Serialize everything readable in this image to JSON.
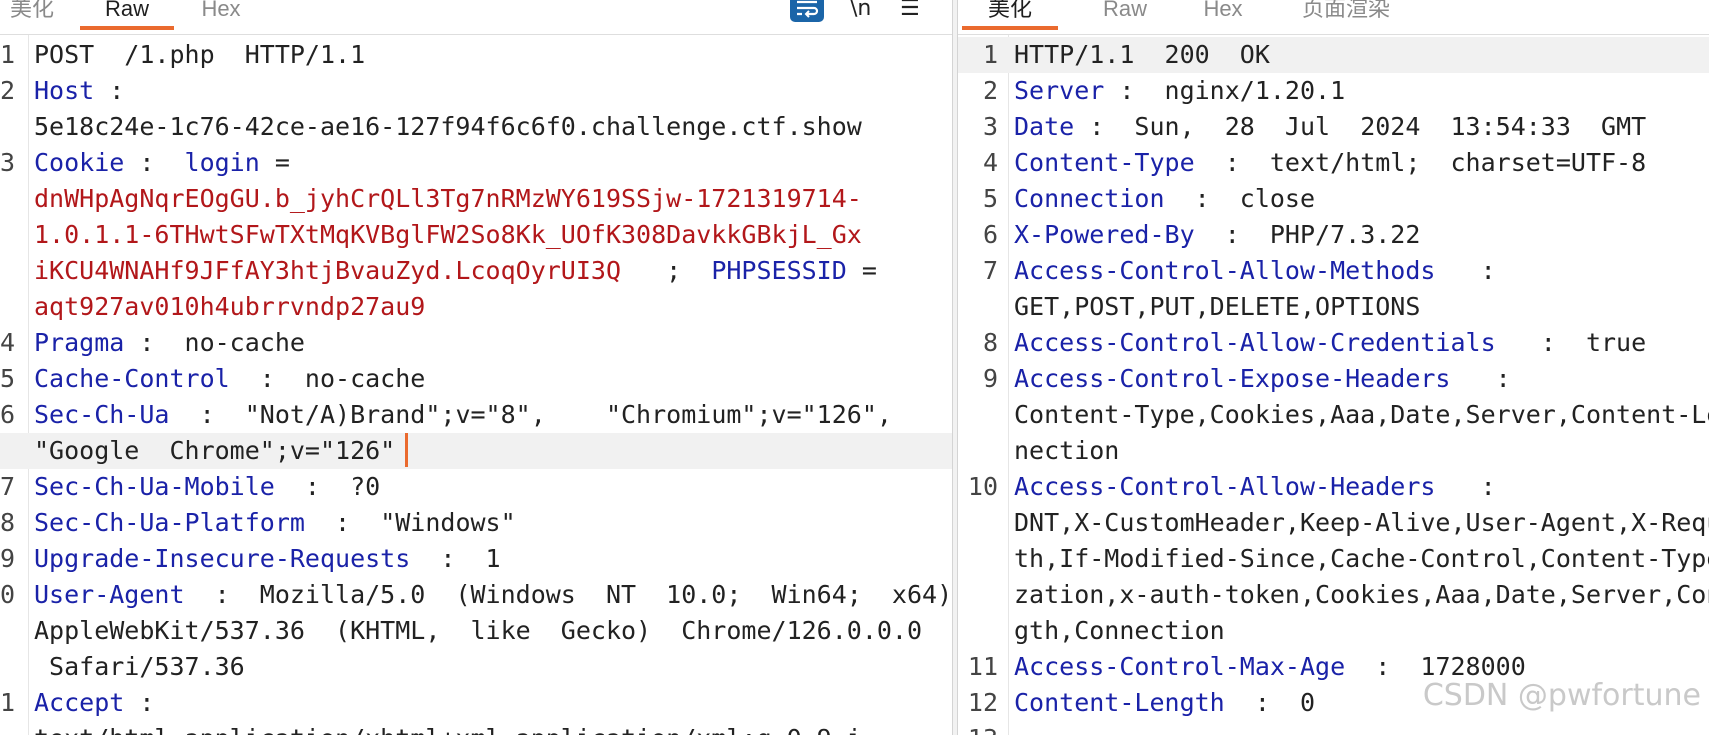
{
  "left": {
    "tabs": [
      "美化",
      "Raw",
      "Hex"
    ],
    "newline_toggle": "\\n",
    "menu_glyph": "☰",
    "lines": [
      {
        "n": "1",
        "parts": [
          {
            "t": "POST  /1.php  HTTP/1.1",
            "c": ""
          }
        ]
      },
      {
        "n": "2",
        "parts": [
          {
            "t": "Host",
            "c": "k"
          },
          {
            "t": " :",
            "c": ""
          }
        ]
      },
      {
        "n": "",
        "parts": [
          {
            "t": "5e18c24e-1c76-42ce-ae16-127f94f6c6f0.challenge.ctf.show",
            "c": ""
          }
        ]
      },
      {
        "n": "3",
        "parts": [
          {
            "t": "Cookie",
            "c": "k"
          },
          {
            "t": " :  ",
            "c": ""
          },
          {
            "t": "login",
            "c": "k"
          },
          {
            "t": " =",
            "c": ""
          }
        ]
      },
      {
        "n": "",
        "parts": [
          {
            "t": "dnWHpAgNqrEOgGU.b_jyhCrQLl3Tg7nRMzWY619SSjw-1721319714-",
            "c": "v"
          }
        ]
      },
      {
        "n": "",
        "parts": [
          {
            "t": "1.0.1.1-6THwtSFwTXtMqKVBglFW2So8Kk_UOfK308DavkkGBkjL_Gx",
            "c": "v"
          }
        ]
      },
      {
        "n": "",
        "parts": [
          {
            "t": "iKCU4WNAHf9JFfAY3htjBvauZyd.LcoqOyrUI3Q",
            "c": "v"
          },
          {
            "t": "   ;  ",
            "c": ""
          },
          {
            "t": "PHPSESSID",
            "c": "k"
          },
          {
            "t": " =",
            "c": ""
          }
        ]
      },
      {
        "n": "",
        "parts": [
          {
            "t": "aqt927av010h4ubrrvndp27au9",
            "c": "v"
          }
        ]
      },
      {
        "n": "4",
        "parts": [
          {
            "t": "Pragma",
            "c": "k"
          },
          {
            "t": " :  no-cache",
            "c": ""
          }
        ]
      },
      {
        "n": "5",
        "parts": [
          {
            "t": "Cache-Control",
            "c": "k"
          },
          {
            "t": "  :  no-cache",
            "c": ""
          }
        ]
      },
      {
        "n": "6",
        "parts": [
          {
            "t": "Sec-Ch-Ua",
            "c": "k"
          },
          {
            "t": "  :  \"Not/A)Brand\";v=\"8\",    \"Chromium\";v=\"126\",",
            "c": ""
          }
        ]
      },
      {
        "n": "",
        "hl": true,
        "cursor": true,
        "parts": [
          {
            "t": "\"Google  Chrome\";v=\"126\"",
            "c": ""
          }
        ]
      },
      {
        "n": "7",
        "parts": [
          {
            "t": "Sec-Ch-Ua-Mobile",
            "c": "k"
          },
          {
            "t": "  :  ?0",
            "c": ""
          }
        ]
      },
      {
        "n": "8",
        "parts": [
          {
            "t": "Sec-Ch-Ua-Platform",
            "c": "k"
          },
          {
            "t": "  :  \"Windows\"",
            "c": ""
          }
        ]
      },
      {
        "n": "9",
        "parts": [
          {
            "t": "Upgrade-Insecure-Requests",
            "c": "k"
          },
          {
            "t": "  :  1",
            "c": ""
          }
        ]
      },
      {
        "n": "0",
        "parts": [
          {
            "t": "User-Agent",
            "c": "k"
          },
          {
            "t": "  :  Mozilla/5.0  (Windows  NT  10.0;  Win64;  x64)",
            "c": ""
          }
        ]
      },
      {
        "n": "",
        "parts": [
          {
            "t": "AppleWebKit/537.36  (KHTML,  like  Gecko)  Chrome/126.0.0.0",
            "c": ""
          }
        ]
      },
      {
        "n": "",
        "parts": [
          {
            "t": " Safari/537.36",
            "c": ""
          }
        ]
      },
      {
        "n": "1",
        "parts": [
          {
            "t": "Accept",
            "c": "k"
          },
          {
            "t": " :",
            "c": ""
          }
        ]
      },
      {
        "n": "",
        "parts": [
          {
            "t": "text/html,application/xhtml+xml,application/xml;q=0.9,i",
            "c": ""
          }
        ]
      }
    ]
  },
  "right": {
    "tabs": [
      "美化",
      "Raw",
      "Hex",
      "页面渲染"
    ],
    "lines": [
      {
        "n": "1",
        "hl": true,
        "parts": [
          {
            "t": "HTTP/1.1  200  OK",
            "c": ""
          }
        ]
      },
      {
        "n": "2",
        "parts": [
          {
            "t": "Server",
            "c": "k"
          },
          {
            "t": " :  nginx/1.20.1",
            "c": ""
          }
        ]
      },
      {
        "n": "3",
        "parts": [
          {
            "t": "Date",
            "c": "k"
          },
          {
            "t": " :  Sun,  28  Jul  2024  13:54:33  GMT",
            "c": ""
          }
        ]
      },
      {
        "n": "4",
        "parts": [
          {
            "t": "Content-Type",
            "c": "k"
          },
          {
            "t": "  :  text/html;  charset=UTF-8",
            "c": ""
          }
        ]
      },
      {
        "n": "5",
        "parts": [
          {
            "t": "Connection",
            "c": "k"
          },
          {
            "t": "  :  close",
            "c": ""
          }
        ]
      },
      {
        "n": "6",
        "parts": [
          {
            "t": "X-Powered-By",
            "c": "k"
          },
          {
            "t": "  :  PHP/7.3.22",
            "c": ""
          }
        ]
      },
      {
        "n": "7",
        "parts": [
          {
            "t": "Access-Control-Allow-Methods",
            "c": "k"
          },
          {
            "t": "   :",
            "c": ""
          }
        ]
      },
      {
        "n": "",
        "parts": [
          {
            "t": "GET,POST,PUT,DELETE,OPTIONS",
            "c": ""
          }
        ]
      },
      {
        "n": "8",
        "parts": [
          {
            "t": "Access-Control-Allow-Credentials",
            "c": "k"
          },
          {
            "t": "   :  true",
            "c": ""
          }
        ]
      },
      {
        "n": "9",
        "parts": [
          {
            "t": "Access-Control-Expose-Headers",
            "c": "k"
          },
          {
            "t": "   :",
            "c": ""
          }
        ]
      },
      {
        "n": "",
        "parts": [
          {
            "t": "Content-Type,Cookies,Aaa,Date,Server,Content-Le",
            "c": ""
          }
        ]
      },
      {
        "n": "",
        "parts": [
          {
            "t": "nection",
            "c": ""
          }
        ]
      },
      {
        "n": "10",
        "parts": [
          {
            "t": "Access-Control-Allow-Headers",
            "c": "k"
          },
          {
            "t": "   :",
            "c": ""
          }
        ]
      },
      {
        "n": "",
        "parts": [
          {
            "t": "DNT,X-CustomHeader,Keep-Alive,User-Agent,X-Requ",
            "c": ""
          }
        ]
      },
      {
        "n": "",
        "parts": [
          {
            "t": "th,If-Modified-Since,Cache-Control,Content-Type",
            "c": ""
          }
        ]
      },
      {
        "n": "",
        "parts": [
          {
            "t": "zation,x-auth-token,Cookies,Aaa,Date,Server,Con",
            "c": ""
          }
        ]
      },
      {
        "n": "",
        "parts": [
          {
            "t": "gth,Connection",
            "c": ""
          }
        ]
      },
      {
        "n": "11",
        "parts": [
          {
            "t": "Access-Control-Max-Age",
            "c": "k"
          },
          {
            "t": "  :  1728000",
            "c": ""
          }
        ]
      },
      {
        "n": "12",
        "parts": [
          {
            "t": "Content-Length",
            "c": "k"
          },
          {
            "t": "  :  0",
            "c": ""
          }
        ]
      },
      {
        "n": "13",
        "parts": []
      }
    ]
  },
  "watermark": "CSDN @pwfortune",
  "colors": {
    "key": "#1a22a8",
    "value": "#b2171a",
    "accent": "#ea6a2e",
    "wrap_icon": "#1b65a8"
  }
}
